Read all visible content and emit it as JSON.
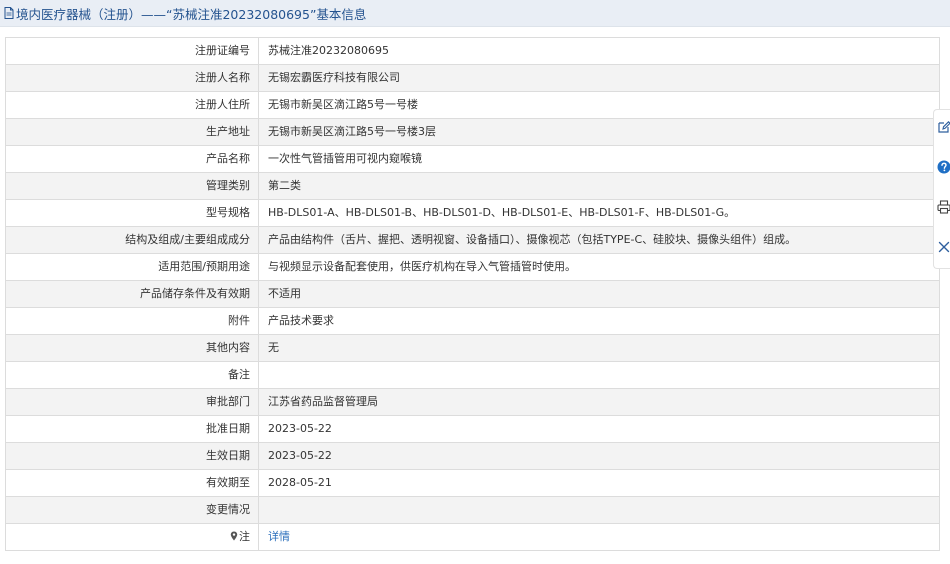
{
  "header": {
    "title": "境内医疗器械（注册）——“苏械注准20232080695”基本信息"
  },
  "rows": [
    {
      "label": "注册证编号",
      "value": "苏械注准20232080695"
    },
    {
      "label": "注册人名称",
      "value": "无锡宏霸医疗科技有限公司"
    },
    {
      "label": "注册人住所",
      "value": "无锡市新吴区滴江路5号一号楼"
    },
    {
      "label": "生产地址",
      "value": "无锡市新吴区滴江路5号一号楼3层"
    },
    {
      "label": "产品名称",
      "value": "一次性气管插管用可视内窥喉镜"
    },
    {
      "label": "管理类别",
      "value": "第二类"
    },
    {
      "label": "型号规格",
      "value": "HB-DLS01-A、HB-DLS01-B、HB-DLS01-D、HB-DLS01-E、HB-DLS01-F、HB-DLS01-G。"
    },
    {
      "label": "结构及组成/主要组成成分",
      "value": "产品由结构件（舌片、握把、透明视窗、设备插口）、摄像视芯（包括TYPE-C、硅胶块、摄像头组件）组成。"
    },
    {
      "label": "适用范围/预期用途",
      "value": "与视频显示设备配套使用，供医疗机构在导入气管插管时使用。"
    },
    {
      "label": "产品储存条件及有效期",
      "value": "不适用"
    },
    {
      "label": "附件",
      "value": "产品技术要求"
    },
    {
      "label": "其他内容",
      "value": "无"
    },
    {
      "label": "备注",
      "value": ""
    },
    {
      "label": "审批部门",
      "value": "江苏省药品监督管理局"
    },
    {
      "label": "批准日期",
      "value": "2023-05-22"
    },
    {
      "label": "生效日期",
      "value": "2023-05-22"
    },
    {
      "label": "有效期至",
      "value": "2028-05-21"
    },
    {
      "label": "变更情况",
      "value": ""
    }
  ],
  "note": {
    "label": "注",
    "link_text": "详情"
  },
  "side_tools": [
    "edit-icon",
    "help-icon",
    "print-icon",
    "close-icon"
  ],
  "colors": {
    "title_text": "#24538f",
    "title_bg": "#e9eef5",
    "link": "#2a6ebb",
    "help_blue": "#1f6fc5"
  }
}
